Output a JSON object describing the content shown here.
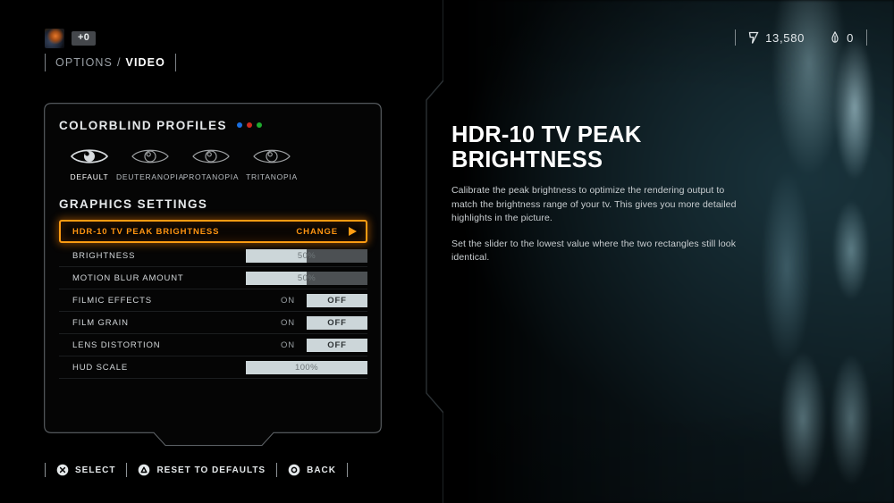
{
  "player": {
    "portrait_icon": "character-portrait",
    "level_badge": "+0"
  },
  "breadcrumb": {
    "parent": "OPTIONS",
    "separator": "/",
    "current": "VIDEO"
  },
  "hud": {
    "currency_icon": "bolt-icon",
    "currency_value": "13,580",
    "resource_icon": "capsule-icon",
    "resource_value": "0"
  },
  "colorblind": {
    "title": "COLORBLIND PROFILES",
    "dots": [
      "#1a6fe0",
      "#cc2a1e",
      "#1faa2e"
    ],
    "profiles": [
      {
        "label": "DEFAULT",
        "icon": "eye-icon-filled",
        "selected": true
      },
      {
        "label": "DEUTERANOPIA",
        "icon": "eye-icon",
        "selected": false
      },
      {
        "label": "PROTANOPIA",
        "icon": "eye-icon",
        "selected": false
      },
      {
        "label": "TRITANOPIA",
        "icon": "eye-icon",
        "selected": false
      }
    ]
  },
  "graphics": {
    "title": "GRAPHICS SETTINGS",
    "accent_color": "#ff9c12",
    "rows": [
      {
        "label": "HDR-10 TV PEAK BRIGHTNESS",
        "type": "action",
        "action_label": "CHANGE",
        "arrow_icon": "triangle-right-icon",
        "active": true
      },
      {
        "label": "BRIGHTNESS",
        "type": "slider",
        "value": "50%",
        "percent": 50
      },
      {
        "label": "MOTION BLUR AMOUNT",
        "type": "slider",
        "value": "50%",
        "percent": 50
      },
      {
        "label": "FILMIC EFFECTS",
        "type": "toggle",
        "option_off": "ON",
        "option_on": "OFF",
        "selected": "OFF"
      },
      {
        "label": "FILM GRAIN",
        "type": "toggle",
        "option_off": "ON",
        "option_on": "OFF",
        "selected": "OFF"
      },
      {
        "label": "LENS DISTORTION",
        "type": "toggle",
        "option_off": "ON",
        "option_on": "OFF",
        "selected": "OFF"
      },
      {
        "label": "HUD SCALE",
        "type": "slider",
        "value": "100%",
        "percent": 100
      }
    ]
  },
  "detail": {
    "title": "HDR-10 TV PEAK BRIGHTNESS",
    "paragraph_1": "Calibrate the peak brightness to optimize the rendering output to match the brightness range of your tv. This gives you more detailed highlights in the picture.",
    "paragraph_2": "Set the slider to the lowest value where the two rectangles still look identical."
  },
  "footer": {
    "prompts": [
      {
        "button": "cross",
        "label": "SELECT"
      },
      {
        "button": "triangle",
        "label": "RESET TO DEFAULTS"
      },
      {
        "button": "circle",
        "label": "BACK"
      }
    ]
  }
}
